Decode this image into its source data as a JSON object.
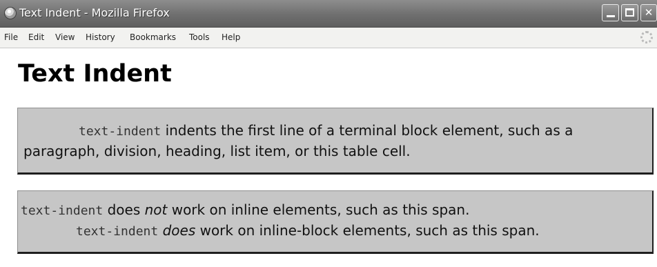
{
  "window": {
    "title": "Text Indent - Mozilla Firefox",
    "minimize_symbol": "",
    "maximize_symbol": "",
    "close_symbol": "✕"
  },
  "menu": [
    "File",
    "Edit",
    "View",
    "History",
    "Bookmarks",
    "Tools",
    "Help"
  ],
  "icons": {
    "app": "firefox-icon",
    "throbber": "loading-throbber-icon"
  },
  "page": {
    "heading": "Text Indent",
    "box1": {
      "code": "text-indent",
      "text": " indents the first line of a terminal block element, such as a paragraph, division, heading, list item, or this table cell."
    },
    "box2": {
      "line1_code": "text-indent",
      "line1_pre": " does ",
      "line1_em": "not",
      "line1_post": " work on inline elements, such as this span.",
      "line2_code": "text-indent",
      "line2_em": "does",
      "line2_post": " work on inline-block elements, such as this span."
    }
  },
  "colors": {
    "box_background": "#c6c6c6",
    "titlebar": "#6f6f6f"
  }
}
